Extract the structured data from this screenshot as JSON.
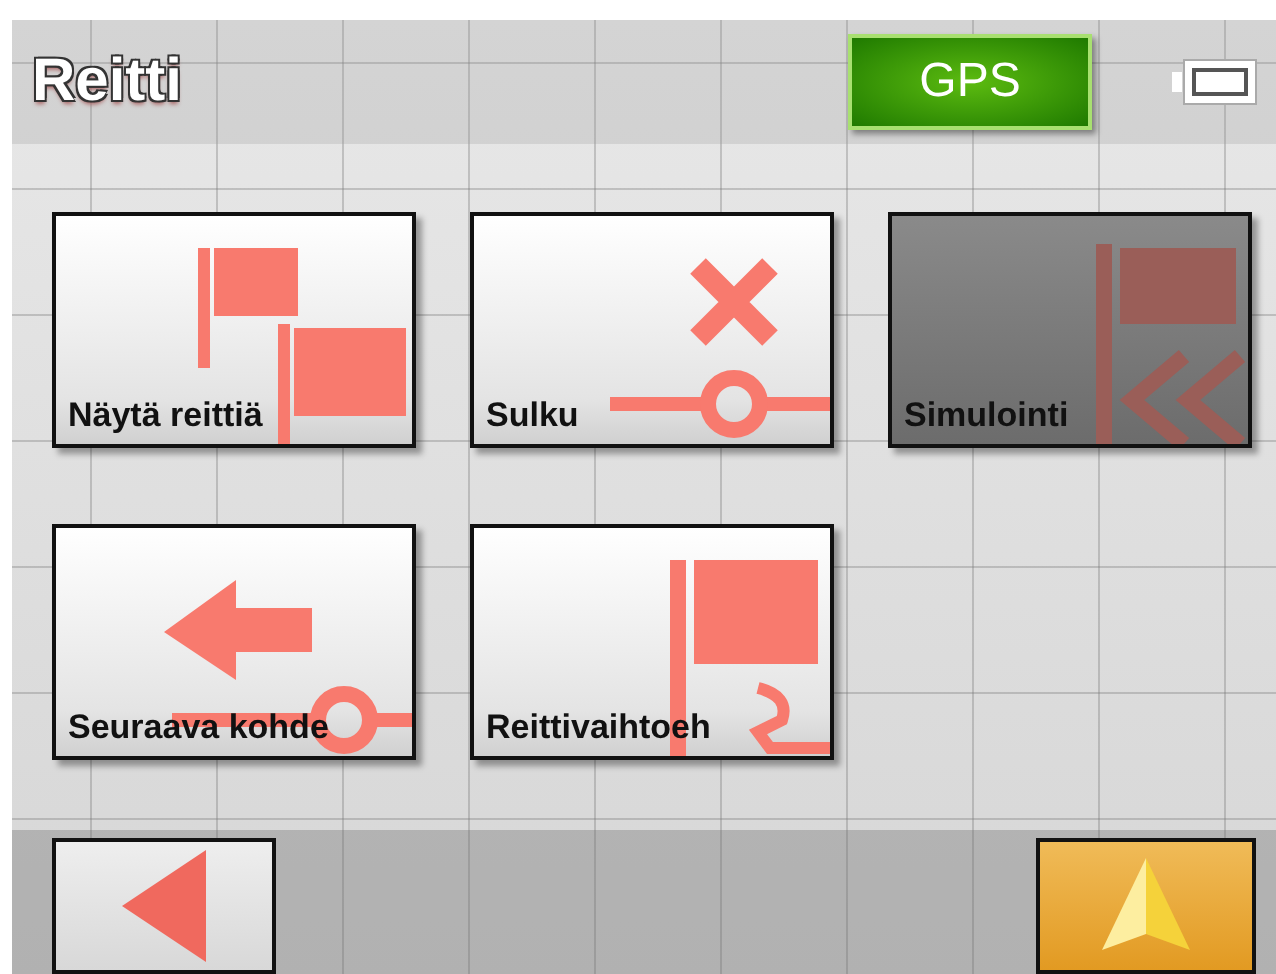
{
  "header": {
    "title": "Reitti",
    "gps_label": "GPS"
  },
  "tiles": [
    {
      "label": "Näytä reittiä",
      "kind": "flags",
      "disabled": false
    },
    {
      "label": "Sulku",
      "kind": "block",
      "disabled": false
    },
    {
      "label": "Simulointi",
      "kind": "simulate",
      "disabled": true
    },
    {
      "label": "Seuraava kohde",
      "kind": "next",
      "disabled": false
    },
    {
      "label": "Reittivaihtoeh",
      "kind": "alternative",
      "disabled": false
    }
  ]
}
